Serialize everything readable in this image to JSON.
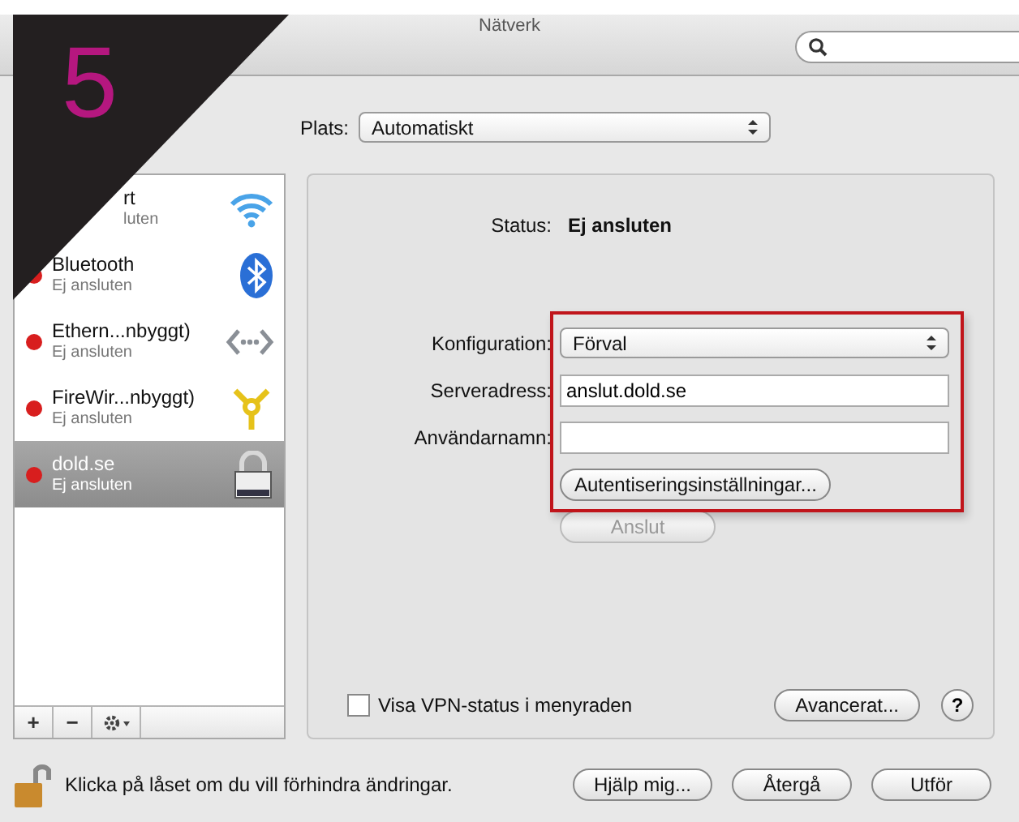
{
  "window": {
    "title": "Nätverk"
  },
  "overlay": {
    "step": "5"
  },
  "location": {
    "label": "Plats:",
    "value": "Automatiskt"
  },
  "services": [
    {
      "name": "rt",
      "status": "luten",
      "kind": "wifi",
      "covered": true,
      "selected": false
    },
    {
      "name": "Bluetooth",
      "status": "Ej ansluten",
      "kind": "bluetooth",
      "covered": false,
      "selected": false
    },
    {
      "name": "Ethern...nbyggt)",
      "status": "Ej ansluten",
      "kind": "ethernet",
      "covered": false,
      "selected": false
    },
    {
      "name": "FireWir...nbyggt)",
      "status": "Ej ansluten",
      "kind": "firewire",
      "covered": false,
      "selected": false
    },
    {
      "name": "dold.se",
      "status": "Ej ansluten",
      "kind": "vpn",
      "covered": false,
      "selected": true
    }
  ],
  "sidebar_tools": [
    "+",
    "−"
  ],
  "status": {
    "label": "Status:",
    "value": "Ej ansluten"
  },
  "config": {
    "label": "Konfiguration:",
    "value": "Förval"
  },
  "fields": [
    {
      "label": "Serveradress:",
      "value": "anslut.dold.se"
    },
    {
      "label": "Användarnamn:"
    }
  ],
  "auth_button": {
    "label": "Autentiseringsinställningar...",
    "highlighted": true
  },
  "connect_button": {
    "label": "Anslut",
    "disabled": true
  },
  "vpn_status": {
    "label": "Visa VPN-status i menyraden",
    "checked": false
  },
  "advanced_button": "Avancerat...",
  "help_button": "?",
  "lock": {
    "text": "Klicka på låset om du vill förhindra ändringar.",
    "locked": false
  },
  "buttons": [
    "Hjälp mig...",
    "Återgå",
    "Utför"
  ]
}
